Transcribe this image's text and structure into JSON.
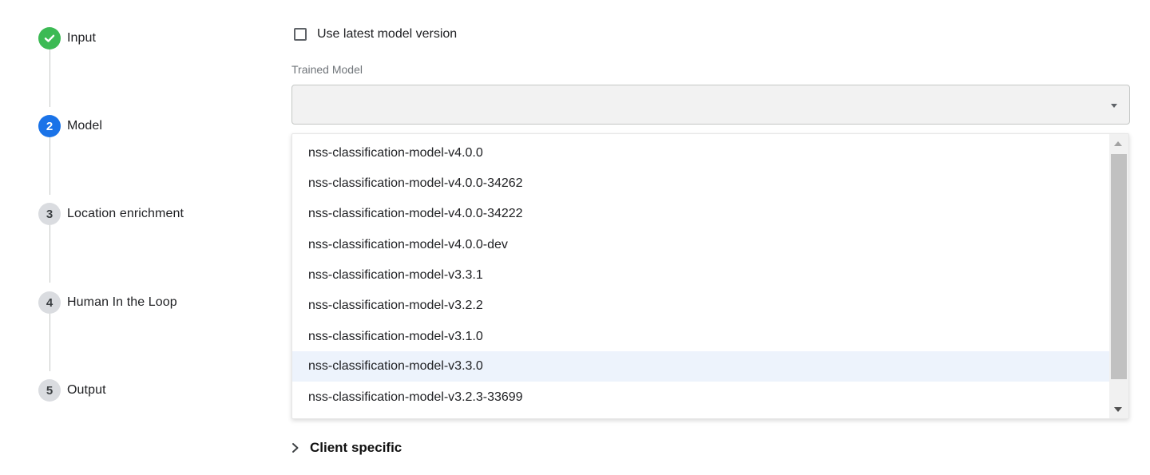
{
  "stepper": {
    "steps": [
      {
        "number": "✓",
        "label": "Input",
        "state": "done"
      },
      {
        "number": "2",
        "label": "Model",
        "state": "active"
      },
      {
        "number": "3",
        "label": "Location enrichment",
        "state": "pending"
      },
      {
        "number": "4",
        "label": "Human In the Loop",
        "state": "pending"
      },
      {
        "number": "5",
        "label": "Output",
        "state": "pending"
      }
    ]
  },
  "form": {
    "latest_checkbox_label": "Use latest model version",
    "latest_checkbox_checked": false,
    "trained_model_label": "Trained Model",
    "trained_model_value": ""
  },
  "dropdown": {
    "options": [
      "nss-classification-model-v4.0.0",
      "nss-classification-model-v4.0.0-34262",
      "nss-classification-model-v4.0.0-34222",
      "nss-classification-model-v4.0.0-dev",
      "nss-classification-model-v3.3.1",
      "nss-classification-model-v3.2.2",
      "nss-classification-model-v3.1.0",
      "nss-classification-model-v3.3.0",
      "nss-classification-model-v3.2.3-33699"
    ],
    "highlighted_option": "nss-classification-model-v3.3.0"
  },
  "client_specific": {
    "label": "Client specific",
    "expanded": false
  },
  "colors": {
    "step_done": "#3cba54",
    "step_active": "#1a73e8",
    "step_pending": "#dadce0",
    "option_highlight": "#edf3fc"
  }
}
